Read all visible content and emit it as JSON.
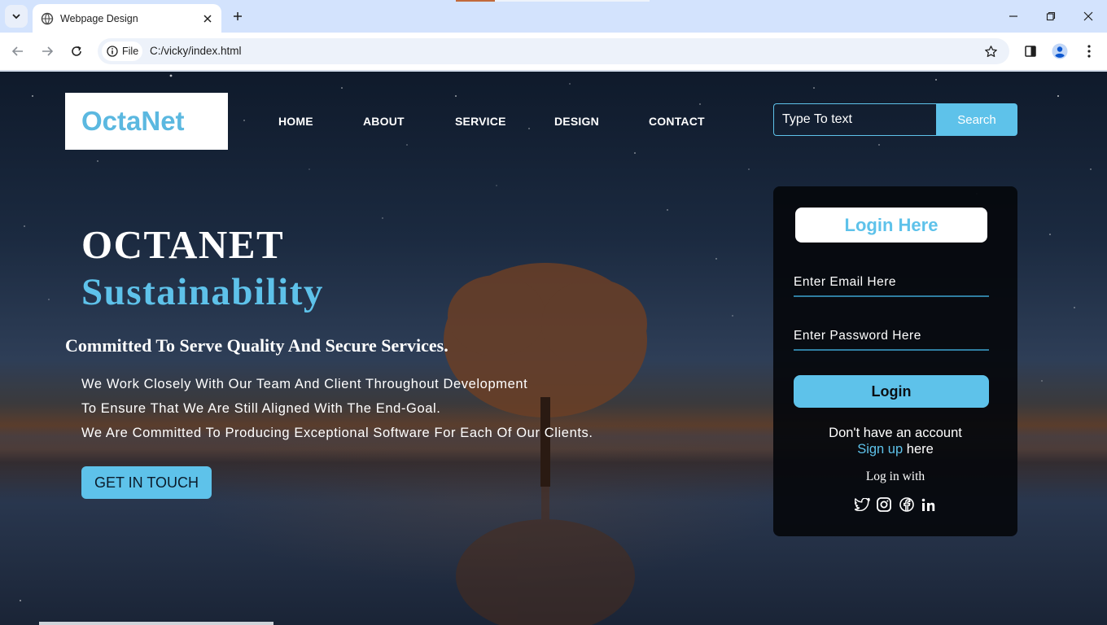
{
  "browser": {
    "tab_title": "Webpage Design",
    "chip_label": "File",
    "url": "C:/vicky/index.html"
  },
  "header": {
    "logo": "OctaNet",
    "nav": [
      "HOME",
      "ABOUT",
      "SERVICE",
      "DESIGN",
      "CONTACT"
    ],
    "search_placeholder": "Type To text",
    "search_button": "Search"
  },
  "hero": {
    "title": "OCTANET",
    "subtitle": "Sustainability",
    "tagline": "Committed To Serve Quality And Secure Services.",
    "paragraph": [
      "We Work Closely With Our Team And Client Throughout Development",
      "To Ensure That We Are Still Aligned With The End-Goal.",
      "We Are Committed To Producing Exceptional Software For Each Of Our Clients."
    ],
    "cta": "GET IN TOUCH"
  },
  "login": {
    "title": "Login Here",
    "email_placeholder": "Enter Email Here",
    "password_placeholder": "Enter Password Here",
    "button": "Login",
    "no_account": "Don't have an account",
    "signup_link": "Sign up",
    "here": "here",
    "login_with": "Log in with",
    "socials": [
      "twitter-icon",
      "instagram-icon",
      "facebook-icon",
      "linkedin-icon"
    ]
  },
  "colors": {
    "accent": "#5ec2ea",
    "logo": "#5bb8e0",
    "card": "#05080c"
  }
}
